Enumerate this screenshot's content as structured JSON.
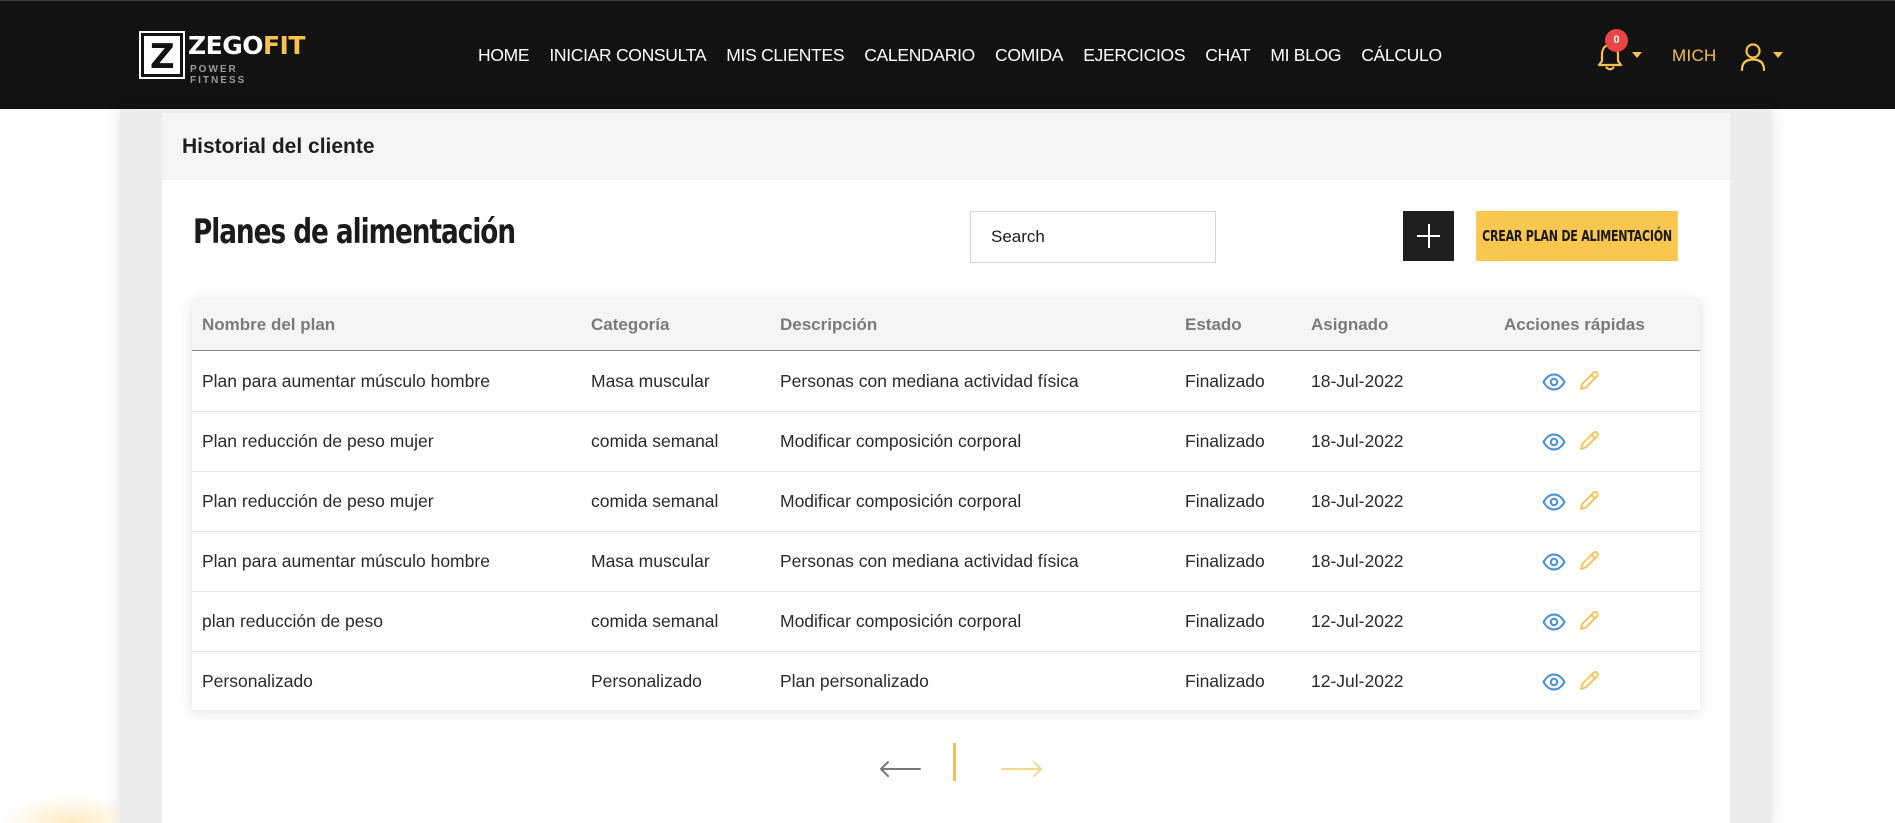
{
  "brand": {
    "logo_letter": "Z",
    "name_part1": "ZEGO",
    "name_part2": "FIT",
    "tagline": "POWER FITNESS"
  },
  "nav": {
    "items": [
      {
        "label": "HOME"
      },
      {
        "label": "INICIAR CONSULTA"
      },
      {
        "label": "MIS CLIENTES"
      },
      {
        "label": "CALENDARIO"
      },
      {
        "label": "COMIDA"
      },
      {
        "label": "EJERCICIOS"
      },
      {
        "label": "CHAT"
      },
      {
        "label": "MI BLOG"
      },
      {
        "label": "CÁLCULO"
      }
    ]
  },
  "notifications": {
    "count": "0",
    "icon": "bell-icon"
  },
  "user": {
    "name": "MICH",
    "icon": "user-icon"
  },
  "card": {
    "title": "Historial del cliente"
  },
  "section": {
    "title": "Planes de alimentación"
  },
  "search": {
    "placeholder": "Search"
  },
  "create_button": {
    "label": "CREAR PLAN DE ALIMENTACIÓN",
    "icon": "plus-icon"
  },
  "table": {
    "headers": [
      "Nombre del plan",
      "Categoría",
      "Descripción",
      "Estado",
      "Asignado",
      "Acciones rápidas"
    ],
    "rows": [
      [
        "Plan para aumentar músculo hombre",
        "Masa muscular",
        "Personas con mediana actividad física",
        "Finalizado",
        "18-Jul-2022"
      ],
      [
        "Plan reducción de peso mujer",
        "comida semanal",
        "Modificar composición corporal",
        "Finalizado",
        "18-Jul-2022"
      ],
      [
        "Plan reducción de peso mujer",
        "comida semanal",
        "Modificar composición corporal",
        "Finalizado",
        "18-Jul-2022"
      ],
      [
        "Plan para aumentar músculo hombre",
        "Masa muscular",
        "Personas con mediana actividad física",
        "Finalizado",
        "18-Jul-2022"
      ],
      [
        "plan reducción de peso",
        "comida semanal",
        "Modificar composición corporal",
        "Finalizado",
        "12-Jul-2022"
      ],
      [
        "Personalizado",
        "Personalizado",
        "Plan personalizado",
        "Finalizado",
        "12-Jul-2022"
      ]
    ],
    "row_actions": [
      "eye-icon",
      "pencil-icon"
    ]
  },
  "pagination": {
    "prev_icon": "arrow-left-icon",
    "next_icon": "arrow-right-icon"
  },
  "colors": {
    "accent": "#f9c74f",
    "topbar": "#121212",
    "eye": "#4a90d9",
    "badge": "#e94545"
  }
}
